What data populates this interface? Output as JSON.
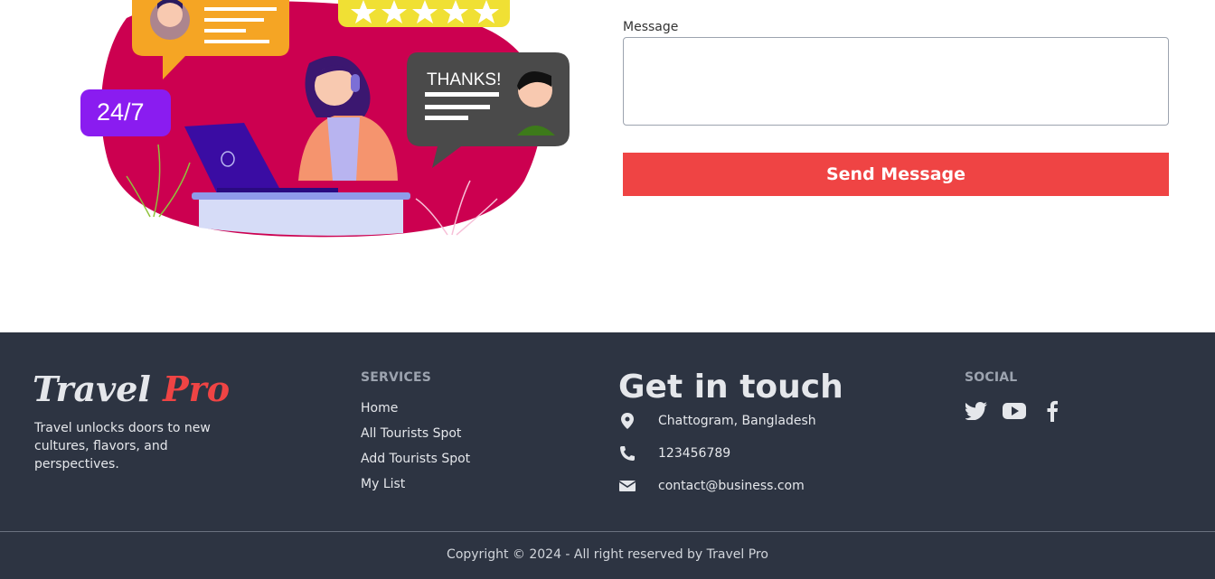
{
  "contact_form": {
    "message_label": "Message",
    "message_value": "",
    "send_label": "Send Message"
  },
  "illustration": {
    "bubble_247": "24/7",
    "bubble_thanks": "THANKS!"
  },
  "footer": {
    "brand_part1": "Travel",
    "brand_part2": "Pro",
    "tagline": "Travel unlocks doors to new cultures, flavors, and perspectives.",
    "services_title": "SERVICES",
    "services": [
      "Home",
      "All Tourists Spot",
      "Add Tourists Spot",
      "My List"
    ],
    "get_in_touch_title": "Get in touch",
    "contacts": {
      "address": "Chattogram, Bangladesh",
      "phone": "123456789",
      "email": "contact@business.com"
    },
    "social_title": "SOCIAL",
    "social_icons": [
      "twitter-icon",
      "youtube-icon",
      "facebook-icon"
    ],
    "copyright": "Copyright © 2024 - All right reserved by Travel Pro"
  },
  "colors": {
    "accent": "#ef4444",
    "footer_bg": "#2d3442",
    "illustration_blob": "#cc0050"
  }
}
